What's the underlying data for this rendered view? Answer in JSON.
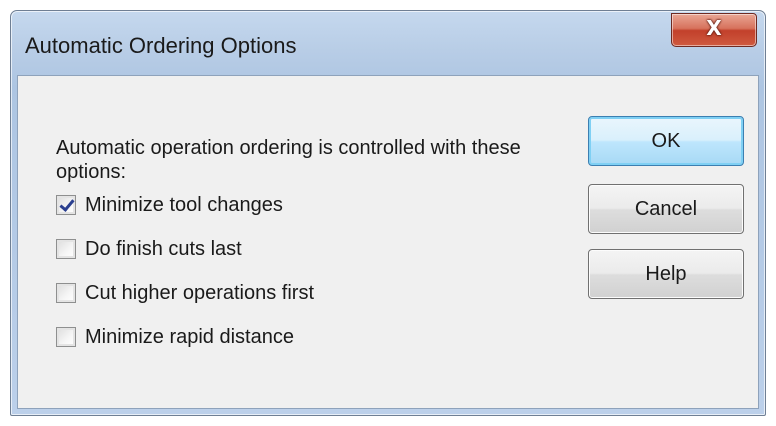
{
  "window": {
    "title": "Automatic Ordering Options",
    "close_glyph": "X",
    "close_icon": "close-icon"
  },
  "intro_text": "Automatic operation ordering is controlled with these options:",
  "options": [
    {
      "label": "Minimize tool changes",
      "checked": true
    },
    {
      "label": "Do finish cuts last",
      "checked": false
    },
    {
      "label": "Cut higher operations first",
      "checked": false
    },
    {
      "label": "Minimize rapid distance",
      "checked": false
    }
  ],
  "buttons": {
    "ok": "OK",
    "cancel": "Cancel",
    "help": "Help"
  },
  "colors": {
    "title_bar": "#b8cde6",
    "close_button": "#c2402b",
    "client_bg": "#f0f0f0",
    "default_button_border": "#3c7fb1",
    "check_mark": "#2a3f8f"
  }
}
